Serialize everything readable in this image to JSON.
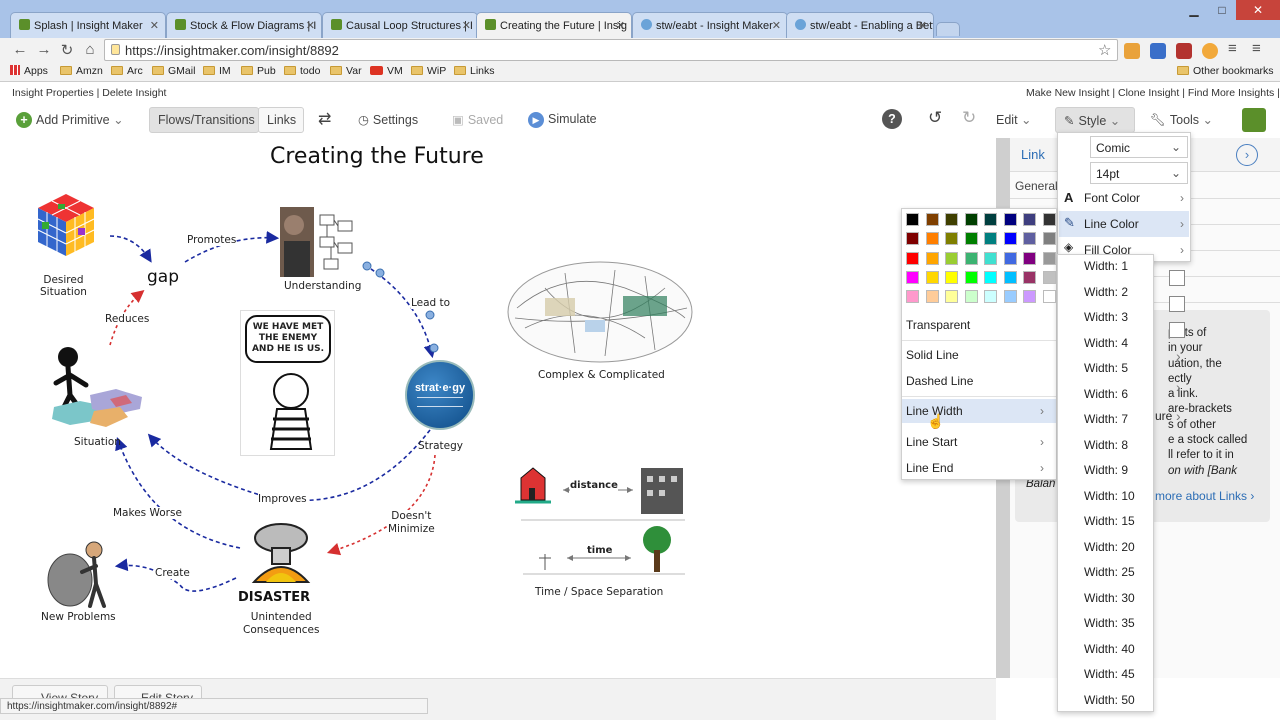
{
  "browser": {
    "tabs": [
      {
        "label": "Splash | Insight Maker",
        "color": "#5b8f2a"
      },
      {
        "label": "Stock & Flow Diagrams | I",
        "color": "#5b8f2a"
      },
      {
        "label": "Causal Loop Structures | I",
        "color": "#5b8f2a"
      },
      {
        "label": "Creating the Future | Insig",
        "color": "#5b8f2a"
      },
      {
        "label": "stw/eabt - Insight Maker",
        "color": "#6aa3d8"
      },
      {
        "label": "stw/eabt - Enabling a Bett",
        "color": "#6aa3d8"
      }
    ],
    "url": "https://insightmaker.com/insight/8892",
    "bookmarks": [
      "Apps",
      "Amzn",
      "Arc",
      "GMail",
      "IM",
      "Pub",
      "todo",
      "Var",
      "VM",
      "WiP",
      "Links"
    ],
    "other_bookmarks": "Other bookmarks",
    "status_url": "https://insightmaker.com/insight/8892#"
  },
  "props": {
    "left": "Insight Properties | Delete Insight",
    "right": "Make New Insight | Clone Insight | Find More Insights | ↓"
  },
  "appbar": {
    "add_primitive": "Add Primitive",
    "flows_transitions": "Flows/Transitions",
    "links": "Links",
    "settings": "Settings",
    "saved": "Saved",
    "simulate": "Simulate",
    "edit": "Edit",
    "style": "Style",
    "tools": "Tools"
  },
  "diagram": {
    "title": "Creating the Future",
    "nodes": {
      "desired": "Desired\nSituation",
      "gap": "gap",
      "understanding": "Understanding",
      "situation": "Situation",
      "strategy": "Strategy",
      "new_problems": "New Problems",
      "unintended": "Unintended\nConsequences",
      "complex": "Complex & Complicated",
      "time_space": "Time / Space Separation",
      "enemy_text": "WE HAVE MET\nTHE ENEMY\nAND HE IS US.",
      "strategy_badge": "strat·e·gy",
      "disaster": "DISASTER",
      "distance": "distance",
      "time": "time"
    },
    "links": {
      "promotes": "Promotes",
      "lead_to": "Lead to",
      "reduces": "Reduces",
      "improves": "Improves",
      "doesnt_minimize": "Doesn't\nMinimize",
      "makes_worse": "Makes Worse",
      "create": "Create"
    }
  },
  "sidepanel": {
    "title": "Link",
    "general": "General",
    "body_lines": [
      "parts of",
      "in your",
      "uation, the",
      "ectly",
      "a link.",
      "are-brackets",
      "s of other",
      "e a stock called",
      "ll refer to it in",
      "on with [Bank",
      "Balan"
    ],
    "learn_more": "more about Links ›",
    "partial_item": "ure"
  },
  "bottom": {
    "view_story": "View Story",
    "edit_story": "Edit Story"
  },
  "color_palette": {
    "swatches": [
      [
        "#000000",
        "#7f3f00",
        "#3f3f00",
        "#003f00",
        "#003f3f",
        "#00007f",
        "#3f3f7f",
        "#333333"
      ],
      [
        "#7f0000",
        "#ff7f00",
        "#7f7f00",
        "#007f00",
        "#007f7f",
        "#0000ff",
        "#5f5fa0",
        "#7f7f7f"
      ],
      [
        "#ff0000",
        "#ffa500",
        "#9acd32",
        "#3cb371",
        "#40e0d0",
        "#4169e1",
        "#800080",
        "#999999"
      ],
      [
        "#ff00ff",
        "#ffd700",
        "#ffff00",
        "#00ff00",
        "#00ffff",
        "#00bfff",
        "#993366",
        "#c0c0c0"
      ],
      [
        "#ff99cc",
        "#ffcc99",
        "#ffff99",
        "#ccffcc",
        "#ccffff",
        "#99ccff",
        "#cc99ff",
        "#ffffff"
      ]
    ],
    "items": [
      "Transparent",
      "Solid Line",
      "Dashed Line",
      "Line Width",
      "Line Start",
      "Line End"
    ]
  },
  "style_menu": {
    "font": "Comic",
    "size": "14pt",
    "items": [
      "Font Color",
      "Line Color",
      "Fill Color"
    ]
  },
  "width_menu": [
    "Width: 1",
    "Width: 2",
    "Width: 3",
    "Width: 4",
    "Width: 5",
    "Width: 6",
    "Width: 7",
    "Width: 8",
    "Width: 9",
    "Width: 10",
    "Width: 15",
    "Width: 20",
    "Width: 25",
    "Width: 30",
    "Width: 35",
    "Width: 40",
    "Width: 45",
    "Width: 50"
  ]
}
